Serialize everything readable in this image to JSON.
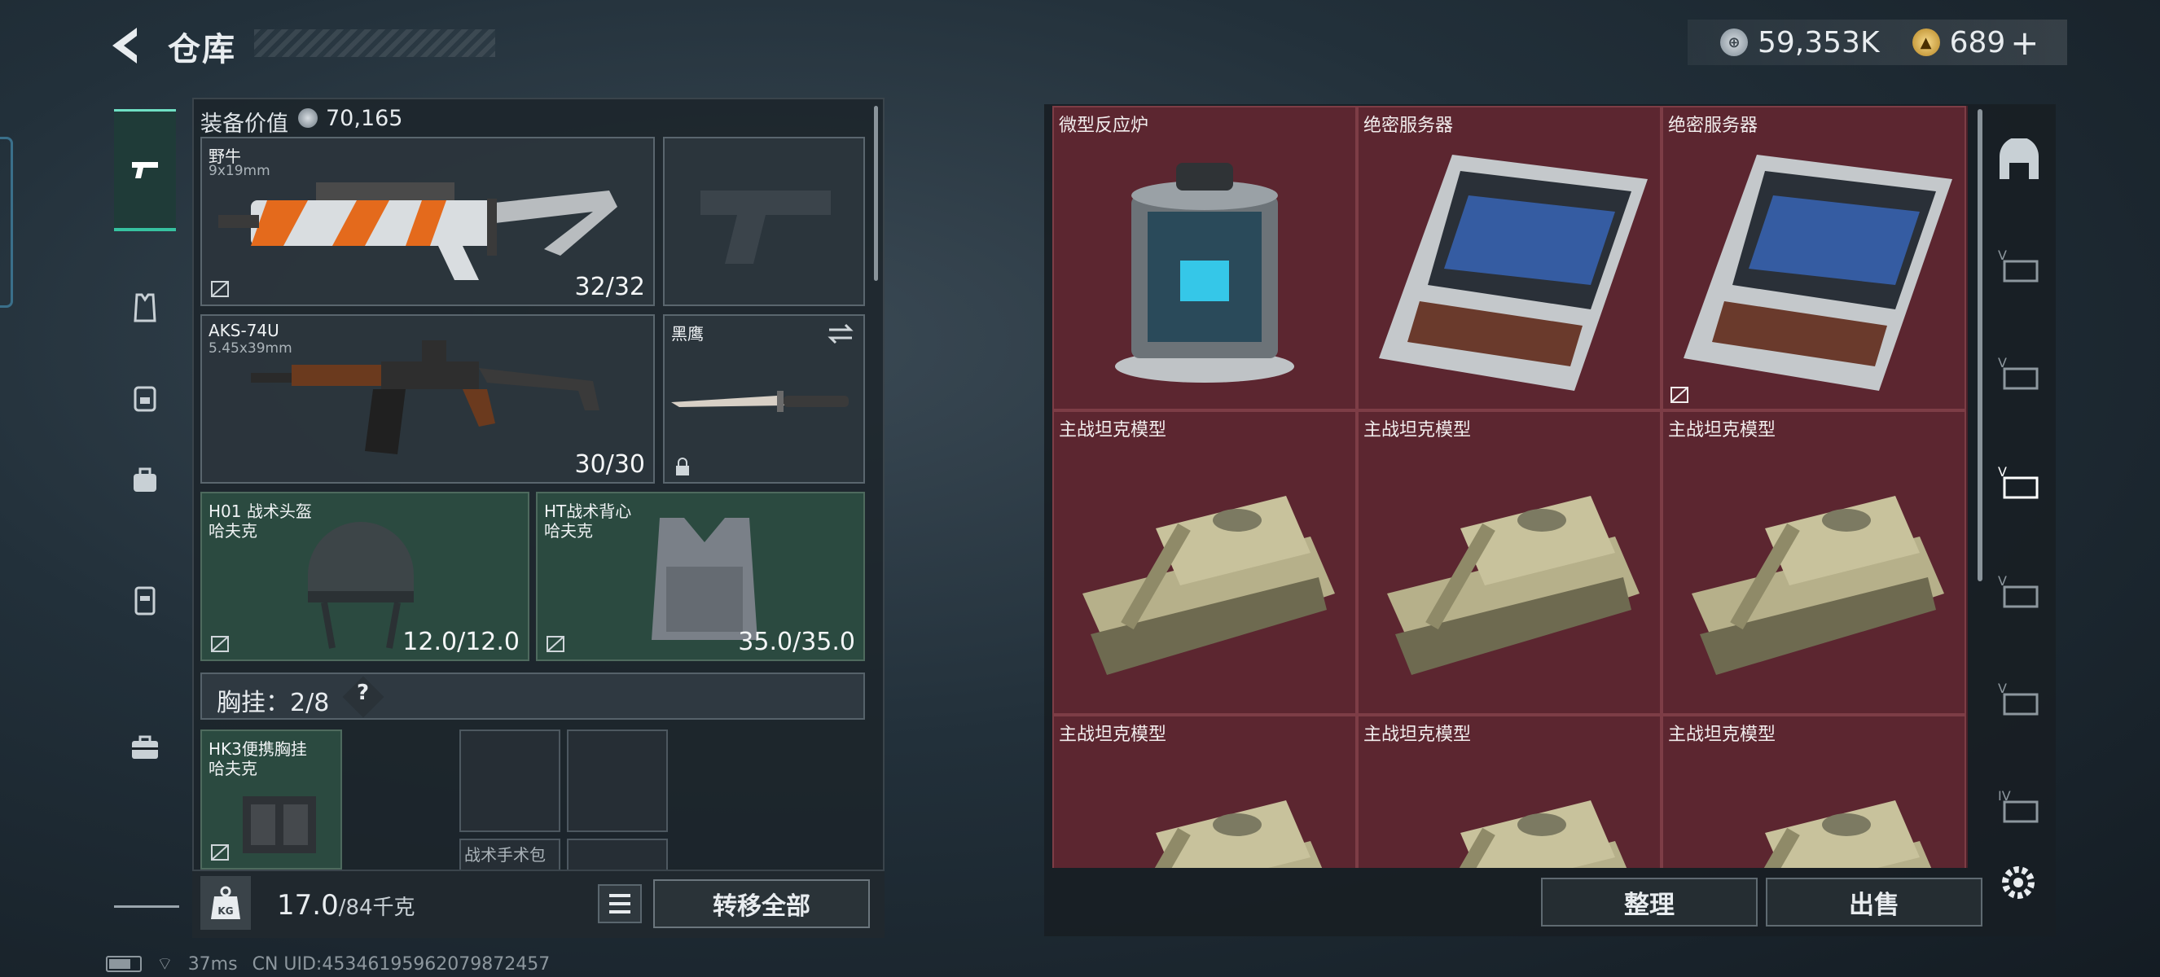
{
  "header": {
    "title": "仓库",
    "currency_silver": "59,353K",
    "currency_gold": "689",
    "add_label": "+"
  },
  "equipment": {
    "value_label": "装备价值",
    "value": "70,165",
    "primary_weapon": {
      "name": "野牛",
      "caliber": "9x19mm",
      "count": "32/32"
    },
    "secondary_weapon": {
      "name": "AKS-74U",
      "caliber": "5.45x39mm",
      "count": "30/30"
    },
    "melee": {
      "name": "黑鹰"
    },
    "helmet": {
      "name": "H01 战术头盔",
      "brand": "哈夫克",
      "durability": "12.0/12.0"
    },
    "armor": {
      "name": "HT战术背心",
      "brand": "哈夫克",
      "durability": "35.0/35.0"
    },
    "chest_rig": {
      "label": "胸挂：2/8",
      "help": "?",
      "name": "HK3便携胸挂",
      "brand": "哈夫克"
    },
    "empty_slot_label": "战术手术包"
  },
  "weight": {
    "current": "17.0",
    "max": "/84千克",
    "kg_label": "KG"
  },
  "actions": {
    "transfer_all": "转移全部",
    "sort": "整理",
    "sell": "出售"
  },
  "storage": {
    "items": [
      {
        "name": "微型反应炉",
        "kind": "reactor",
        "locked": false
      },
      {
        "name": "绝密服务器",
        "kind": "server",
        "locked": false
      },
      {
        "name": "绝密服务器",
        "kind": "server",
        "locked": true
      },
      {
        "name": "主战坦克模型",
        "kind": "tank",
        "locked": false
      },
      {
        "name": "主战坦克模型",
        "kind": "tank",
        "locked": false
      },
      {
        "name": "主战坦克模型",
        "kind": "tank",
        "locked": false
      },
      {
        "name": "主战坦克模型",
        "kind": "tank",
        "locked": false
      },
      {
        "name": "主战坦克模型",
        "kind": "tank",
        "locked": false
      },
      {
        "name": "主战坦克模型",
        "kind": "tank",
        "locked": false
      }
    ]
  },
  "right_rail": {
    "tier_label": "IV"
  },
  "status": {
    "ping": "37ms",
    "uid": "CN UID:4534619596207987​2457"
  },
  "colors": {
    "accent": "#36c2a0",
    "storage_bg": "#5c2630"
  }
}
